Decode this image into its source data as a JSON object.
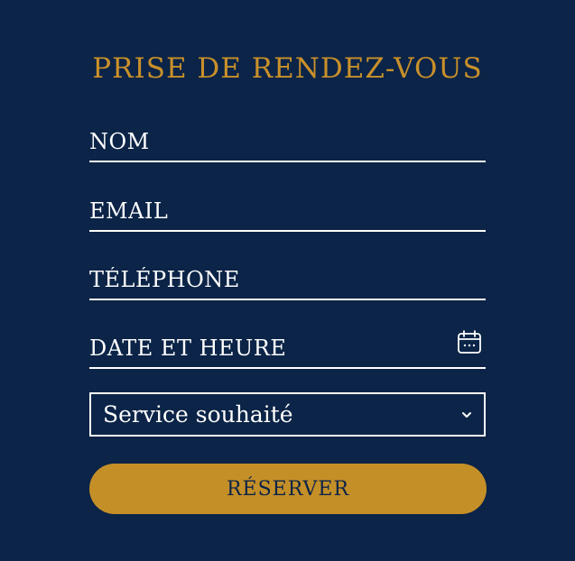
{
  "form": {
    "title": "PRISE DE RENDEZ-VOUS",
    "fields": {
      "nom": {
        "placeholder": "NOM",
        "value": ""
      },
      "email": {
        "placeholder": "EMAIL",
        "value": ""
      },
      "telephone": {
        "placeholder": "TÉLÉPHONE",
        "value": ""
      },
      "date_heure": {
        "placeholder": "DATE ET HEURE",
        "value": "",
        "icon": "calendar-icon"
      }
    },
    "service_select": {
      "selected": "Service souhaité",
      "icon": "chevron-down-icon"
    },
    "submit_label": "RÉSERVER"
  },
  "colors": {
    "background": "#0b2447",
    "accent": "#c9902a",
    "button": "#c58f28",
    "text": "#ffffff"
  }
}
